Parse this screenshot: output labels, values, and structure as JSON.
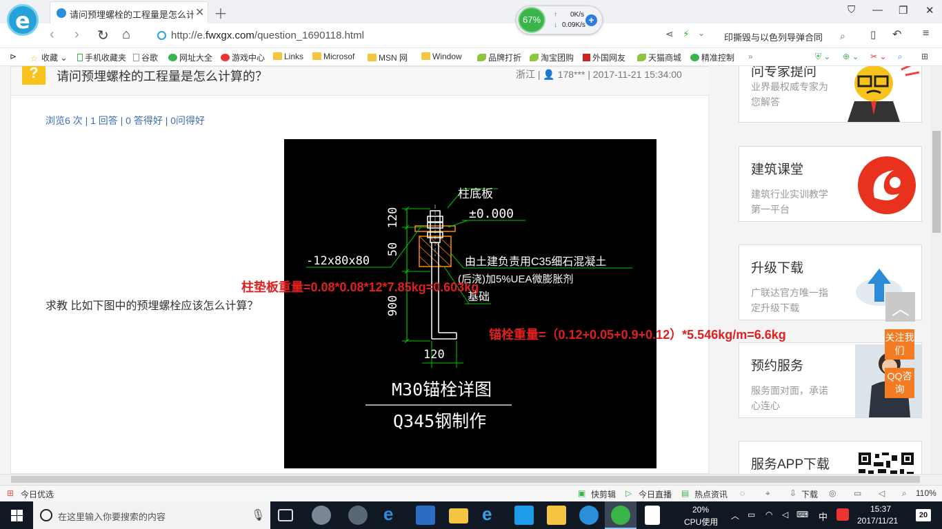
{
  "browser": {
    "tab_title": "请问预埋螺栓的工程量是怎么计算的？",
    "url_prefix": "http://e.",
    "url_domain": "fwxgx.com",
    "url_path": "/question_1690118.html",
    "search_text": "印撕毁与以色列导弹合同",
    "gauge_percent": "67%",
    "upload_speed": "0K/s",
    "download_speed": "0.09K/s"
  },
  "bookmarks": [
    "收藏",
    "手机收藏夹",
    "谷歌",
    "网址大全",
    "游戏中心",
    "Links",
    "Microsof",
    "MSN 网",
    "Window",
    "品牌打折",
    "淘宝团购",
    "外国网友",
    "天猫商城",
    "精准控制"
  ],
  "question": {
    "title": "请问预埋螺栓的工程量是怎么计算的？",
    "meta": "浙江 | 👤 178*** | 2017-11-21 15:34:00",
    "stats": "浏览6 次 | 1 回答 | 0 答得好 | 0问得好",
    "ask_text": "求教 比如下图中的预埋螺栓应该怎么计算？"
  },
  "drawing": {
    "label_plate": "柱底板",
    "elevation": "±0.000",
    "dim_120_top": "120",
    "dim_50": "50",
    "dim_900": "900",
    "dim_120_bottom": "120",
    "plate_spec": "-12x80x80",
    "note_line1": "由土建负责用C35细石混凝土",
    "note_line2": "(后浇)加5%UEA微膨胀剂",
    "foundation": "基础",
    "title": "M30锚栓详图",
    "material": "Q345钢制作"
  },
  "annotations": {
    "plate_weight": "柱垫板重量=0.08*0.08*12*7.85kg=0.603kg",
    "anchor_weight": "锚栓重量=（0.12+0.05+0.9+0.12）*5.546kg/m=6.6kg"
  },
  "sidebar": {
    "cards": [
      {
        "title": "问专家提问",
        "desc": "业界最权威专家为您解答"
      },
      {
        "title": "建筑课堂",
        "desc": "建筑行业实训教学第一平台"
      },
      {
        "title": "升级下载",
        "desc": "广联达官方唯一指定升级下载"
      },
      {
        "title": "预约服务",
        "desc": "服务面对面，承诺心连心"
      },
      {
        "title": "服务APP下载",
        "desc": ""
      }
    ],
    "follow_label": "关注我们",
    "qq_label": "QQ咨询"
  },
  "statusbar": {
    "left": "今日优选",
    "items": [
      "快剪辑",
      "今日直播",
      "热点资讯",
      "下载"
    ],
    "zoom": "110%"
  },
  "taskbar": {
    "search_placeholder": "在这里输入你要搜索的内容",
    "cpu_percent": "20%",
    "cpu_label": "CPU使用",
    "ime": "中",
    "time": "15:37",
    "date": "2017/11/21",
    "notif_count": "20"
  },
  "colors": {
    "accent": "#27a2d9",
    "annotation_red": "#e02020",
    "cad_green": "#00c800",
    "cad_orange": "#ff8a00"
  }
}
